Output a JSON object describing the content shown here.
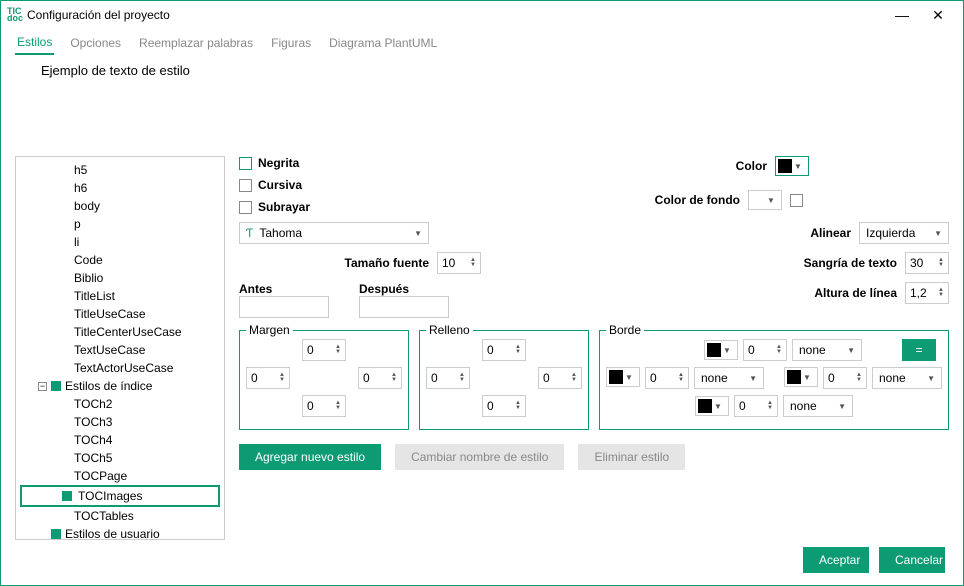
{
  "window": {
    "title": "Configuración del proyecto"
  },
  "tabs": {
    "t0": "Estilos",
    "t1": "Opciones",
    "t2": "Reemplazar palabras",
    "t3": "Figuras",
    "t4": "Diagrama PlantUML"
  },
  "example": "Ejemplo de texto de estilo",
  "tree": {
    "items": [
      "h5",
      "h6",
      "body",
      "p",
      "li",
      "Code",
      "Biblio",
      "TitleList",
      "TitleUseCase",
      "TitleCenterUseCase",
      "TextUseCase",
      "TextActorUseCase"
    ],
    "group1": "Estilos de índice",
    "toc": [
      "TOCh2",
      "TOCh3",
      "TOCh4",
      "TOCh5",
      "TOCPage"
    ],
    "selected": "TOCImages",
    "after": "TOCTables",
    "group2": "Estilos de usuario"
  },
  "labels": {
    "bold": "Negrita",
    "italic": "Cursiva",
    "underline": "Subrayar",
    "color": "Color",
    "bgcolor": "Color de fondo",
    "align": "Alinear",
    "fontsize": "Tamaño fuente",
    "indent": "Sangría de texto",
    "before": "Antes",
    "after": "Después",
    "lineheight": "Altura de línea",
    "margin": "Margen",
    "padding": "Relleno",
    "border": "Borde"
  },
  "values": {
    "font": "Tahoma",
    "align": "Izquierda",
    "fontsize": "10",
    "indent": "30",
    "lineheight": "1,2",
    "m": {
      "t": "0",
      "r": "0",
      "b": "0",
      "l": "0"
    },
    "p": {
      "t": "0",
      "r": "0",
      "b": "0",
      "l": "0"
    },
    "b": {
      "tw": "0",
      "rw": "0",
      "bw": "0",
      "lw": "0",
      "style": "none"
    }
  },
  "buttons": {
    "add": "Agregar nuevo estilo",
    "rename": "Cambiar nombre de estilo",
    "delete": "Eliminar estilo",
    "ok": "Aceptar",
    "cancel": "Cancelar",
    "eq": "="
  }
}
